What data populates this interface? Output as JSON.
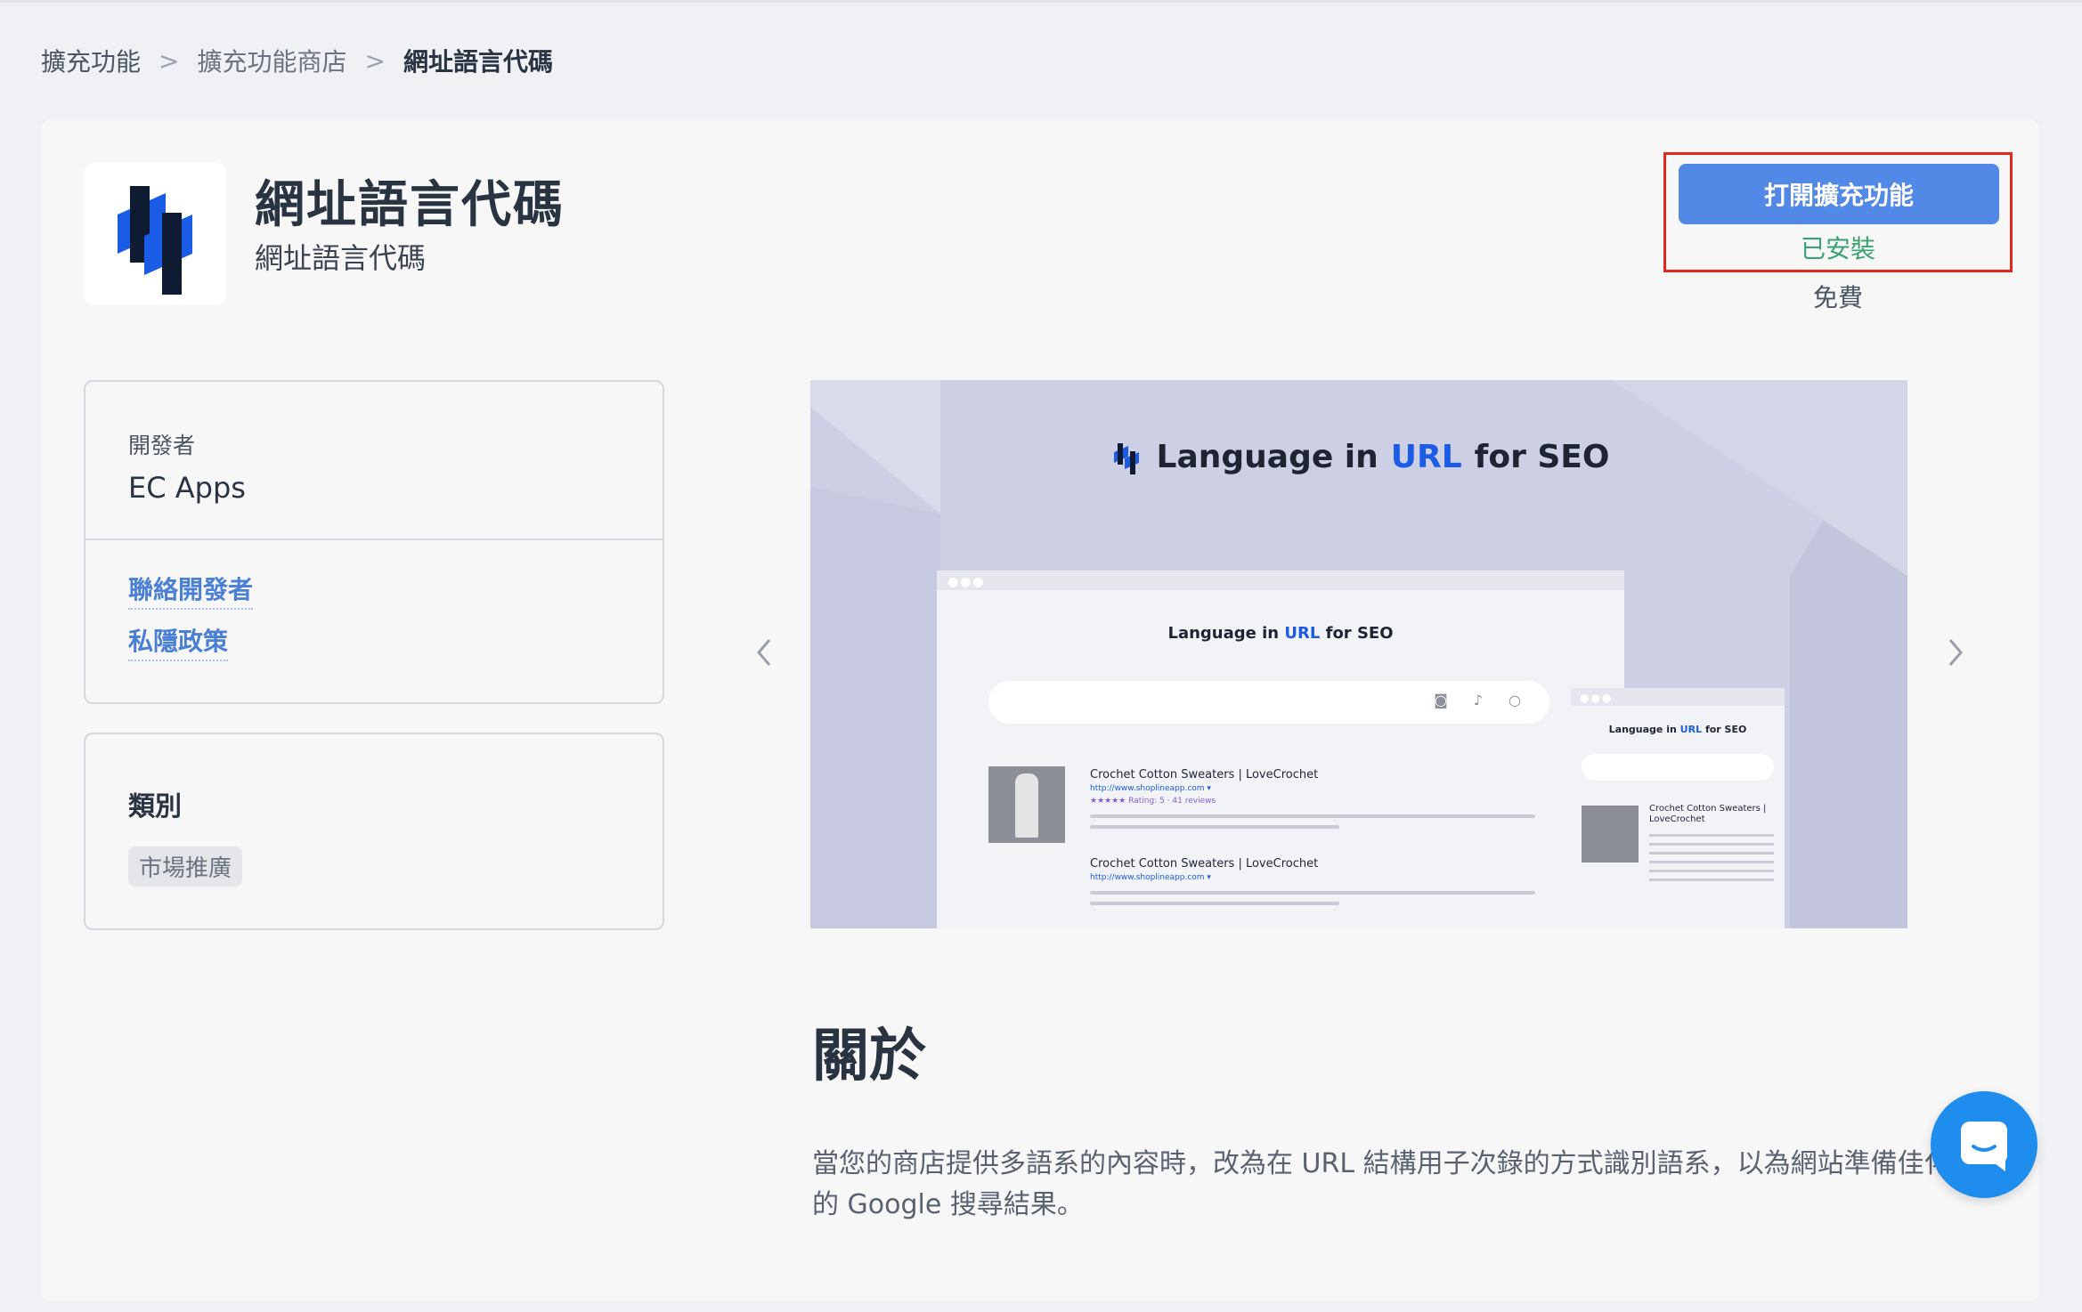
{
  "breadcrumb": {
    "items": [
      "擴充功能",
      "擴充功能商店",
      "網址語言代碼"
    ],
    "separator": ">"
  },
  "app": {
    "title": "網址語言代碼",
    "subtitle": "網址語言代碼",
    "logo_icon": "app-logo-icon"
  },
  "actions": {
    "open_label": "打開擴充功能",
    "installed_label": "已安裝",
    "price_label": "免費"
  },
  "developer": {
    "label": "開發者",
    "name": "EC Apps",
    "contact_link": "聯絡開發者",
    "privacy_link": "私隱政策"
  },
  "category": {
    "title": "類別",
    "tag": "市場推廣"
  },
  "screenshot": {
    "heading_pre": "Language in",
    "heading_url": "URL",
    "heading_post": "for SEO",
    "result_title_1": "Crochet Cotton Sweaters | LoveCrochet",
    "result_title_2": "Crochet Cotton Sweaters | LoveCrochet",
    "result_link": "http://www.shoplineapp.com ▾",
    "result_rating": "★★★★★ Rating: 5 · 41 reviews",
    "mobile_result_title": "Crochet Cotton Sweaters | LoveCrochet"
  },
  "carousel": {
    "prev_icon": "chevron-left-icon",
    "next_icon": "chevron-right-icon"
  },
  "about": {
    "title": "關於",
    "text": "當您的商店提供多語系的內容時，改為在 URL 結構用子次錄的方式識別語系，以為網站準備佳化的 Google 搜尋結果。"
  },
  "chat": {
    "icon": "chat-bubble-icon"
  },
  "colors": {
    "primary": "#5289e6",
    "installed": "#3aa36f",
    "highlight_border": "#e0281f",
    "link": "#4a7fd6",
    "brand_blue": "#1b5ce6",
    "chat": "#1f8ded"
  }
}
